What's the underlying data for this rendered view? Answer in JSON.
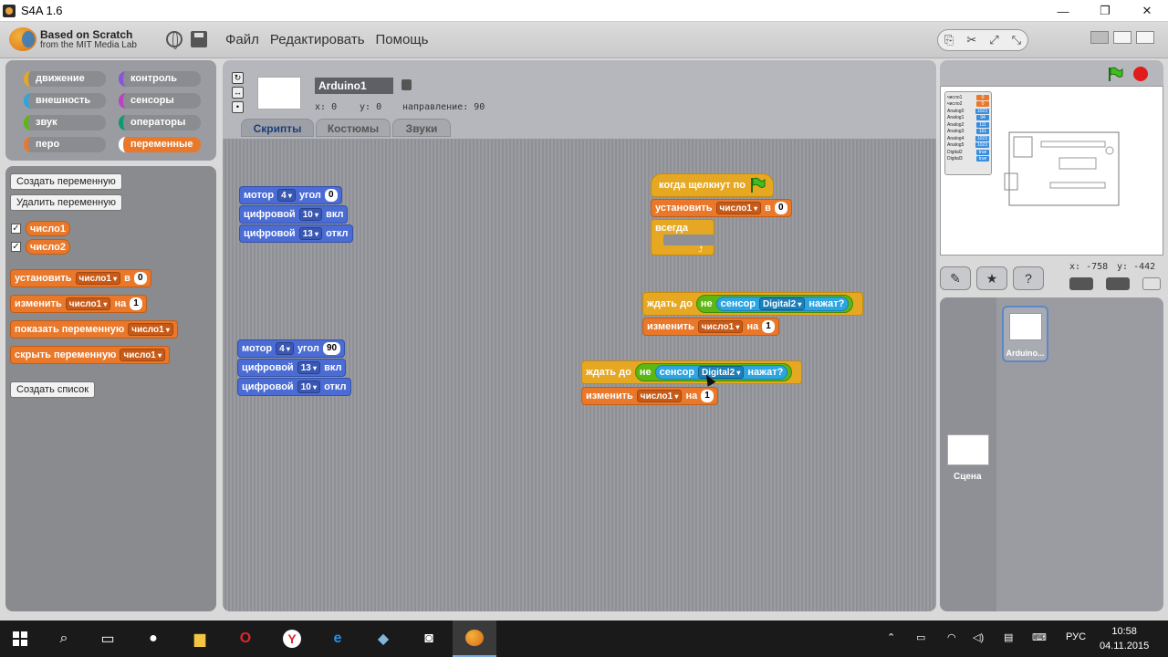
{
  "window": {
    "title": "S4A 1.6",
    "minimize": "—",
    "maximize": "❐",
    "close": "✕"
  },
  "logo": {
    "line1": "Based on Scratch",
    "line2": "from the MIT Media Lab"
  },
  "menu": [
    "Файл",
    "Редактировать",
    "Помощь"
  ],
  "categories": [
    {
      "label": "движение",
      "color": "#4a6cd4"
    },
    {
      "label": "контроль",
      "color": "#e6a822"
    },
    {
      "label": "внешность",
      "color": "#8a55d7"
    },
    {
      "label": "сенсоры",
      "color": "#2ca5e2"
    },
    {
      "label": "звук",
      "color": "#bb42c3"
    },
    {
      "label": "операторы",
      "color": "#5cb712"
    },
    {
      "label": "перо",
      "color": "#0e9a6c"
    },
    {
      "label": "переменные",
      "color": "#e9782a",
      "active": true
    }
  ],
  "palette": {
    "create_var": "Создать переменную",
    "delete_var": "Удалить переменную",
    "vars": [
      "число1",
      "число2"
    ],
    "set_block": {
      "label": "установить",
      "var": "число1",
      "to": "в",
      "value": "0"
    },
    "change_block": {
      "label": "изменить",
      "var": "число1",
      "by": "на",
      "value": "1"
    },
    "show_block": {
      "label": "показать переменную",
      "var": "число1"
    },
    "hide_block": {
      "label": "скрыть переменную",
      "var": "число1"
    },
    "create_list": "Создать список"
  },
  "sprite": {
    "name": "Arduino1",
    "x_label": "x:",
    "x": "0",
    "y_label": "y:",
    "y": "0",
    "dir_label": "направление:",
    "dir": "90"
  },
  "tabs": [
    "Скрипты",
    "Костюмы",
    "Звуки"
  ],
  "scripts": {
    "group1": [
      {
        "label": "мотор",
        "pin": "4",
        "word": "угол",
        "value": "0"
      },
      {
        "label": "цифровой",
        "pin": "10",
        "word": "вкл"
      },
      {
        "label": "цифровой",
        "pin": "13",
        "word": "откл"
      }
    ],
    "group2": [
      {
        "label": "мотор",
        "pin": "4",
        "word": "угол",
        "value": "90"
      },
      {
        "label": "цифровой",
        "pin": "13",
        "word": "вкл"
      },
      {
        "label": "цифровой",
        "pin": "10",
        "word": "откл"
      }
    ],
    "hat": {
      "label": "когда щелкнут по"
    },
    "set": {
      "label": "установить",
      "var": "число1",
      "to": "в",
      "value": "0"
    },
    "forever": {
      "label": "всегда"
    },
    "wait1": {
      "label": "ждать до",
      "not": "не",
      "sensor": "сенсор",
      "name": "Digital2",
      "pressed": "нажат?"
    },
    "change1": {
      "label": "изменить",
      "var": "число1",
      "by": "на",
      "value": "1"
    },
    "wait2": {
      "label": "ждать до",
      "not": "не",
      "sensor": "сенсор",
      "name": "Digital2",
      "pressed": "нажат?"
    },
    "change2": {
      "label": "изменить",
      "var": "число1",
      "by": "на",
      "value": "1"
    }
  },
  "stage": {
    "monitor": [
      {
        "name": "число1",
        "value": "0"
      },
      {
        "name": "число2",
        "value": "0"
      },
      {
        "name": "Analog0",
        "value": "1023"
      },
      {
        "name": "Analog1",
        "value": "94"
      },
      {
        "name": "Analog2",
        "value": "111"
      },
      {
        "name": "Analog3",
        "value": "151"
      },
      {
        "name": "Analog4",
        "value": "1023"
      },
      {
        "name": "Analog5",
        "value": "1023"
      },
      {
        "name": "Digital2",
        "value": "true"
      },
      {
        "name": "Digital3",
        "value": "true"
      }
    ],
    "mouse_x_label": "x:",
    "mouse_x": "-758",
    "mouse_y_label": "y:",
    "mouse_y": "-442"
  },
  "sprite_list": {
    "sprite_name": "Arduino...",
    "stage_name": "Сцена"
  },
  "taskbar": {
    "lang": "РУС",
    "time": "10:58",
    "date": "04.11.2015"
  }
}
